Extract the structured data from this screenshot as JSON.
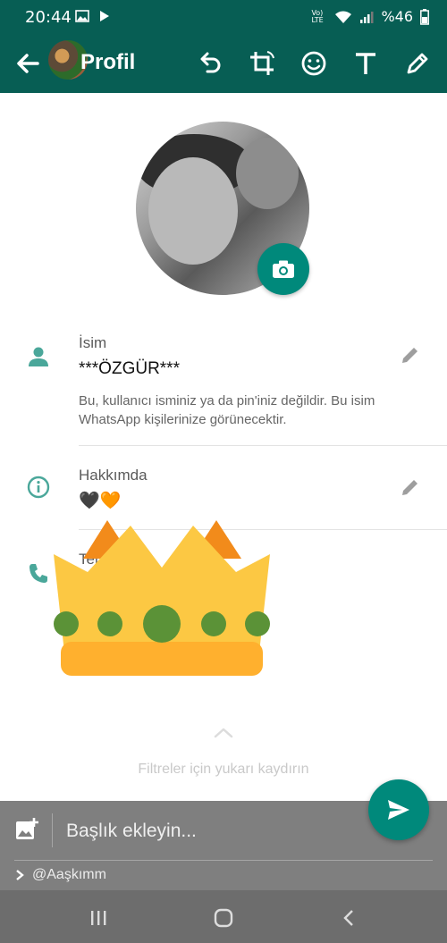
{
  "status_bar": {
    "time": "20:44",
    "network_label": "Vo) LTE",
    "battery_text": "%46"
  },
  "app_bar": {
    "title": "Profil",
    "icons": [
      "back-arrow-icon",
      "undo-icon",
      "crop-rotate-icon",
      "emoji-icon",
      "text-icon",
      "pencil-icon"
    ]
  },
  "profile": {
    "name_label": "İsim",
    "name_value": "***ÖZGÜR***",
    "name_description": "Bu, kullanıcı isminiz ya da pin'iniz değildir. Bu isim WhatsApp kişilerinize görünecektir.",
    "about_label": "Hakkımda",
    "about_value": "🖤🧡",
    "phone_label_partial": "Tel"
  },
  "overlay": {
    "sticker": "crown-sticker",
    "filter_hint": "Filtreler için yukarı kaydırın"
  },
  "caption_bar": {
    "placeholder": "Başlık ekleyin...",
    "recipient": "@Aaşkımm"
  },
  "colors": {
    "header": "#075e54",
    "accent": "#00897b",
    "crown_gold": "#fcc843",
    "crown_orange": "#f28b1b",
    "crown_green": "#5b9237"
  }
}
